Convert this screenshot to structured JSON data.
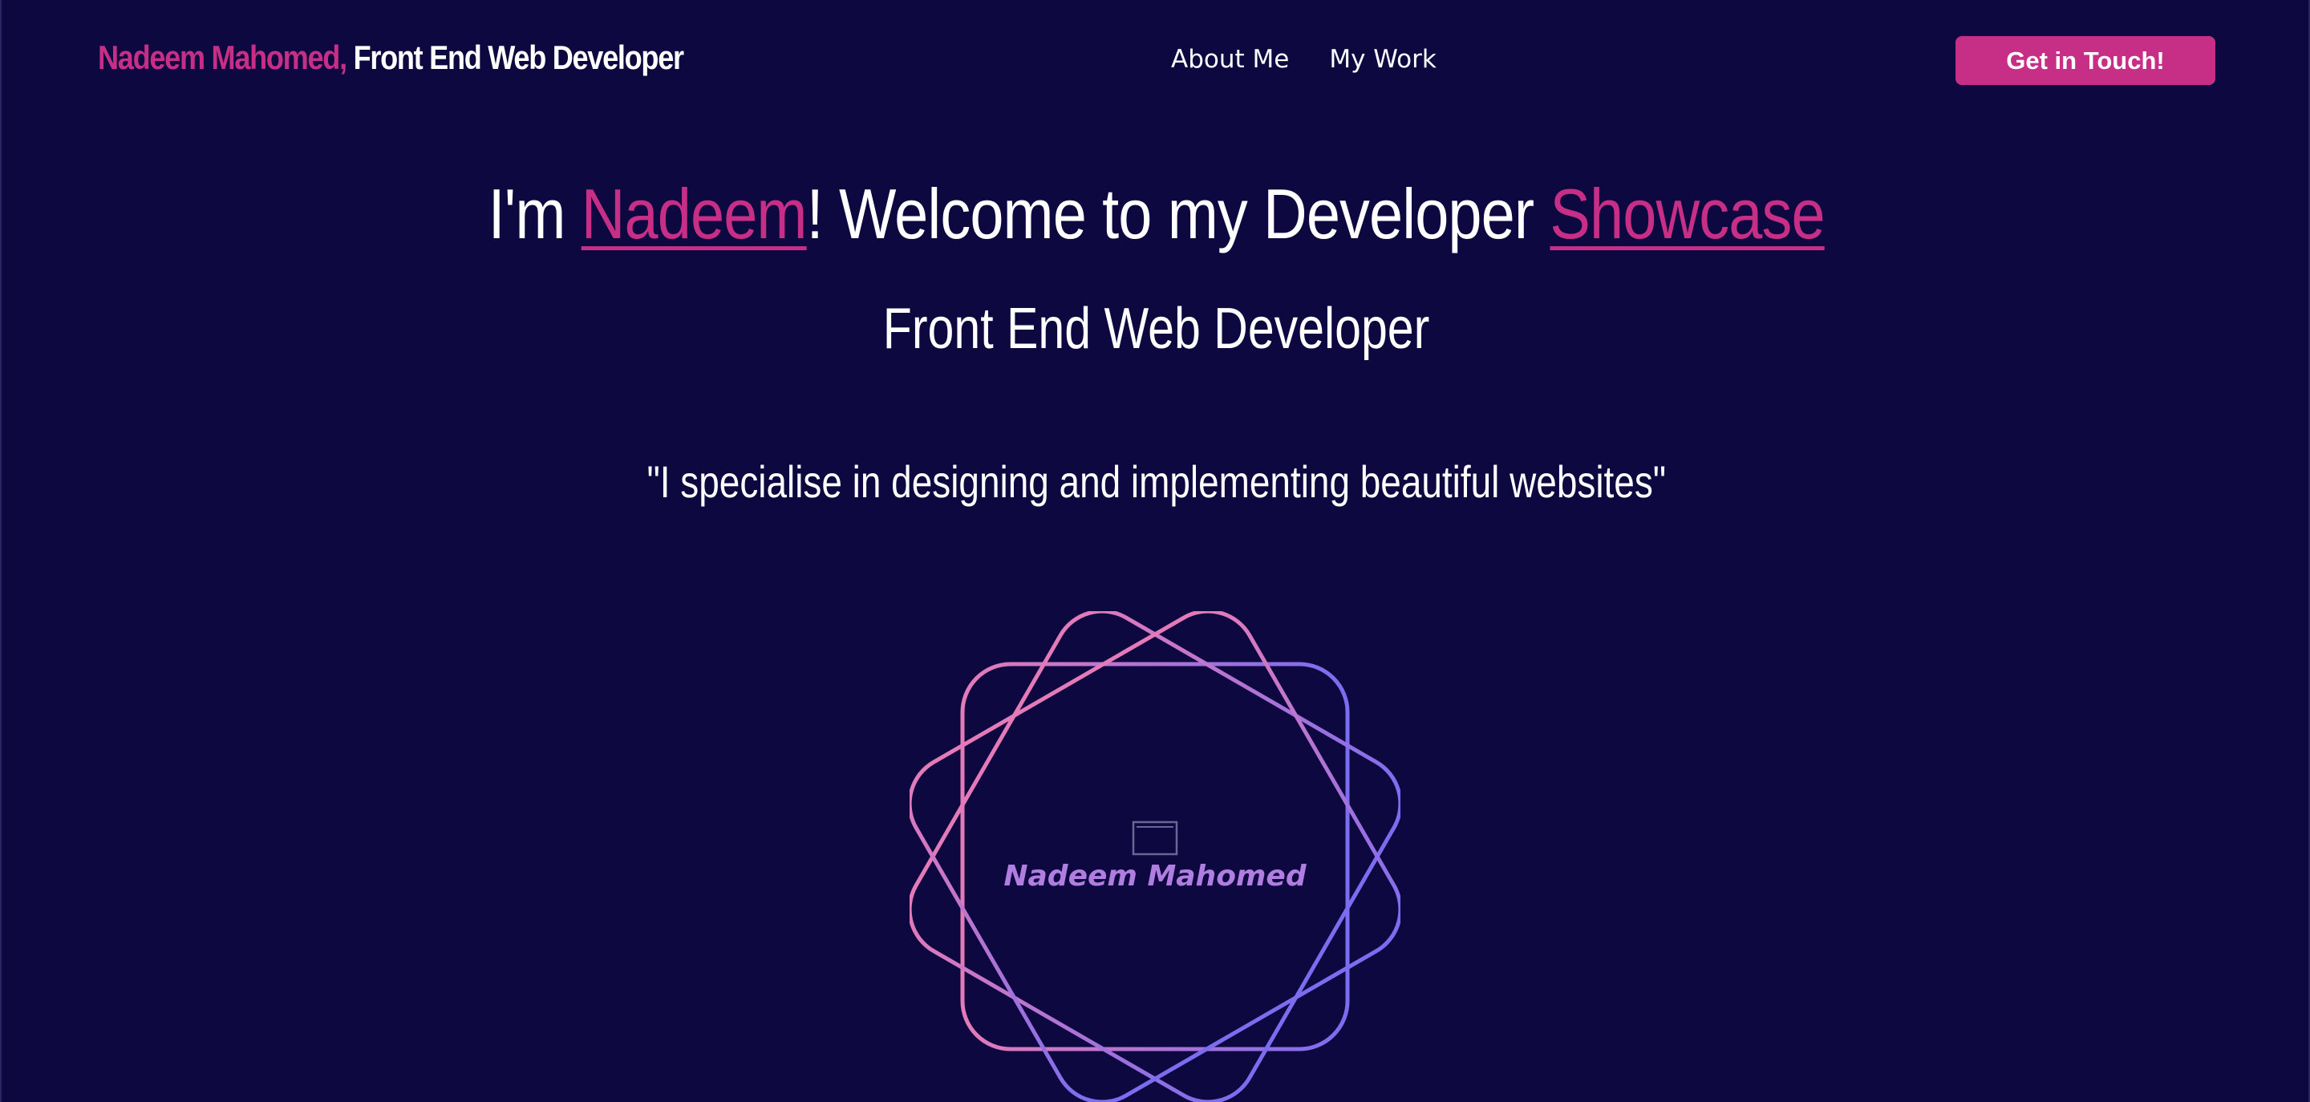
{
  "header": {
    "brand_name": "Nadeem Mahomed,",
    "brand_role": "Front End Web Developer",
    "nav": [
      {
        "label": "About Me"
      },
      {
        "label": "My Work"
      }
    ],
    "cta_label": "Get in Touch!"
  },
  "hero": {
    "title_pre": "I'm ",
    "title_name": "Nadeem",
    "title_mid": "! Welcome to my Developer ",
    "title_showcase": "Showcase",
    "subtitle": "Front End Web Developer",
    "quote": "\"I specialise in designing and implementing beautiful websites\""
  },
  "logo": {
    "text": "Nadeem Mahomed",
    "icon": "browser-window-icon",
    "gradient_start": "#e47bb8",
    "gradient_end": "#7b6cf0"
  },
  "colors": {
    "background": "#0d0840",
    "accent": "#c72f86"
  }
}
